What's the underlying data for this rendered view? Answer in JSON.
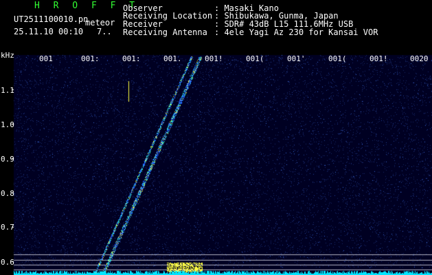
{
  "app_name": "H R O F F T",
  "file_name": "UT2511100010.pn",
  "event_type": "meteor",
  "date_time": "25.11.10 00:10",
  "frame_index": "7..",
  "info_labels": [
    "Observer",
    "Receiving Location",
    "Receiver",
    "Receiving Antenna"
  ],
  "info_values": [
    ": Masaki Kano",
    ": Shibukawa, Gunma, Japan",
    ": SDR# 43dB L15 111.6MHz USB",
    ": 4ele Yagi Az 230 for Kansai VOR"
  ],
  "y_unit": "kHz",
  "y_ticks": [
    "1.1",
    "1.0",
    "0.9",
    "0.8",
    "0.7",
    "0.6"
  ],
  "x_ticks": [
    "001",
    "001:",
    "001:",
    "001.",
    "001!",
    "001(",
    "001'",
    "001(",
    "001!",
    "0020"
  ],
  "colors": {
    "background": "#000022",
    "noise": "#1a2a6b",
    "signal_low": "#2060ff",
    "signal_mid": "#30e0c0",
    "signal_high": "#ffff40",
    "baseline": "#00e5ff",
    "title_green": "#33ff33"
  }
}
